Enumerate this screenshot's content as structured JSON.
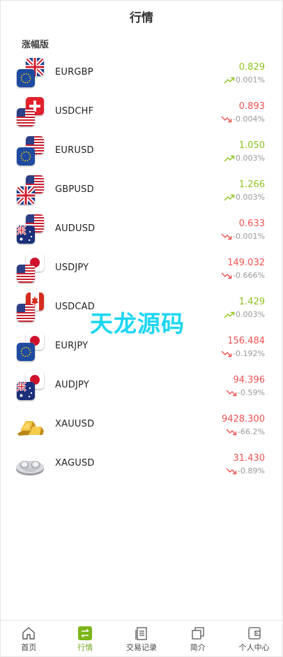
{
  "header": {
    "title": "行情"
  },
  "section": {
    "title": "涨幅版"
  },
  "quotes": [
    {
      "symbol": "EURGBP",
      "price": "0.829",
      "change": "0.001%",
      "dir": "up"
    },
    {
      "symbol": "USDCHF",
      "price": "0.893",
      "change": "-0.004%",
      "dir": "down"
    },
    {
      "symbol": "EURUSD",
      "price": "1.050",
      "change": "0.003%",
      "dir": "up"
    },
    {
      "symbol": "GBPUSD",
      "price": "1.266",
      "change": "0.003%",
      "dir": "up"
    },
    {
      "symbol": "AUDUSD",
      "price": "0.633",
      "change": "-0.001%",
      "dir": "down"
    },
    {
      "symbol": "USDJPY",
      "price": "149.032",
      "change": "-0.666%",
      "dir": "down"
    },
    {
      "symbol": "USDCAD",
      "price": "1.429",
      "change": "0.003%",
      "dir": "up"
    },
    {
      "symbol": "EURJPY",
      "price": "156.484",
      "change": "-0.192%",
      "dir": "down"
    },
    {
      "symbol": "AUDJPY",
      "price": "94.396",
      "change": "-0.59%",
      "dir": "down"
    },
    {
      "symbol": "XAUUSD",
      "price": "9428.300",
      "change": "-66.2%",
      "dir": "down"
    },
    {
      "symbol": "XAGUSD",
      "price": "31.430",
      "change": "-0.89%",
      "dir": "down"
    }
  ],
  "watermark": "天龙源码",
  "tabs": [
    {
      "label": "首页",
      "icon": "home-icon"
    },
    {
      "label": "行情",
      "icon": "exchange-icon",
      "active": true
    },
    {
      "label": "交易记录",
      "icon": "document-icon"
    },
    {
      "label": "简介",
      "icon": "copy-icon"
    },
    {
      "label": "个人中心",
      "icon": "wallet-icon"
    }
  ],
  "colors": {
    "up": "#8fc31f",
    "down": "#f0524f",
    "accent": "#6aa81a",
    "watermark": "#1bd6f5"
  }
}
